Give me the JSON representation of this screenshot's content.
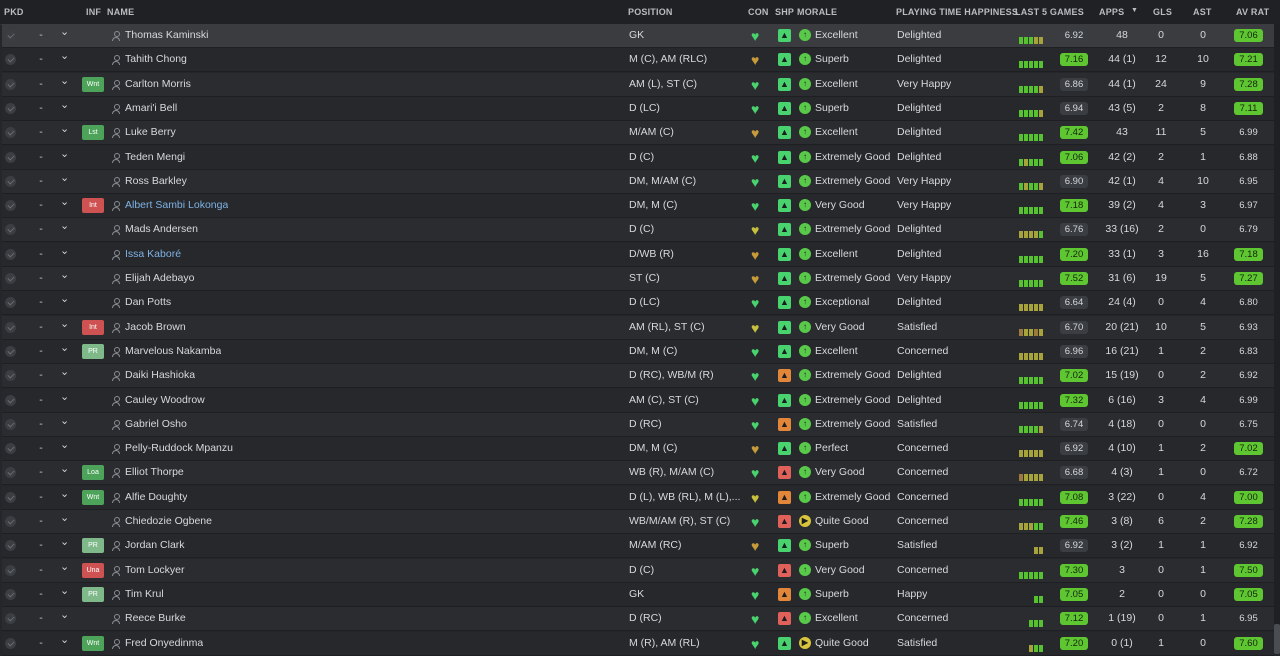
{
  "headers": {
    "pkd": "PKD",
    "inf": "INF",
    "name": "NAME",
    "position": "POSITION",
    "con": "CON",
    "shp": "SHP",
    "morale": "MORALE",
    "playing_time": "PLAYING TIME HAPPINESS",
    "last5": "LAST 5 GAMES",
    "apps": "APPS",
    "sort_indicator": "▼",
    "gls": "GLS",
    "ast": "AST",
    "av_rat": "AV RAT"
  },
  "colors": {
    "bar_green": "#57c22f",
    "bar_olive": "#a5a33a",
    "bar_brown": "#9b7a3c",
    "badge_green": "#4da35a",
    "badge_red": "#cf5252",
    "badge_light": "#7fb889",
    "heart_green": "#49d36e",
    "heart_gold": "#c89b3a",
    "heart_yellow": "#c7c03e",
    "shp_green": "#49d36e",
    "shp_orange": "#e2863a",
    "shp_red": "#e0605a",
    "morale_green": "#59c94a",
    "morale_yellow": "#d9c53c"
  },
  "players": [
    {
      "name": "Thomas Kaminski",
      "inf": "",
      "pkd": "-",
      "position": "GK",
      "con": "heart-green",
      "shp": "green",
      "morale": "Excellent",
      "morale_icon": "up",
      "happiness": "Delighted",
      "last5": [
        "g",
        "g",
        "g",
        "o",
        "o"
      ],
      "l5": "6.92",
      "l5hi": false,
      "apps": "48",
      "gls": "0",
      "ast": "0",
      "avr": "7.06",
      "avrhi": true,
      "link": false
    },
    {
      "name": "Tahith Chong",
      "inf": "",
      "pkd": "-",
      "position": "M (C), AM (RLC)",
      "con": "heart-gold",
      "shp": "green",
      "morale": "Superb",
      "morale_icon": "up",
      "happiness": "Delighted",
      "last5": [
        "g",
        "g",
        "g",
        "g",
        "g"
      ],
      "l5": "7.16",
      "l5hi": true,
      "apps": "44 (1)",
      "gls": "12",
      "ast": "10",
      "avr": "7.21",
      "avrhi": true,
      "link": false
    },
    {
      "name": "Carlton Morris",
      "inf": "Wnt",
      "inf_color": "green",
      "pkd": "-",
      "position": "AM (L), ST (C)",
      "con": "heart-green",
      "shp": "green",
      "morale": "Excellent",
      "morale_icon": "up",
      "happiness": "Very Happy",
      "last5": [
        "g",
        "g",
        "g",
        "g",
        "o"
      ],
      "l5": "6.86",
      "l5hi": false,
      "apps": "44 (1)",
      "gls": "24",
      "ast": "9",
      "avr": "7.28",
      "avrhi": true,
      "link": false
    },
    {
      "name": "Amari'i Bell",
      "inf": "",
      "pkd": "-",
      "position": "D (LC)",
      "con": "heart-green",
      "shp": "green",
      "morale": "Superb",
      "morale_icon": "up",
      "happiness": "Delighted",
      "last5": [
        "g",
        "g",
        "g",
        "g",
        "o"
      ],
      "l5": "6.94",
      "l5hi": false,
      "apps": "43 (5)",
      "gls": "2",
      "ast": "8",
      "avr": "7.11",
      "avrhi": true,
      "link": false
    },
    {
      "name": "Luke Berry",
      "inf": "Lst",
      "inf_color": "green",
      "pkd": "-",
      "position": "M/AM (C)",
      "con": "heart-gold",
      "shp": "green",
      "morale": "Excellent",
      "morale_icon": "up",
      "happiness": "Delighted",
      "last5": [
        "g",
        "g",
        "g",
        "g",
        "g"
      ],
      "l5": "7.42",
      "l5hi": true,
      "apps": "43",
      "gls": "11",
      "ast": "5",
      "avr": "6.99",
      "avrhi": false,
      "link": false
    },
    {
      "name": "Teden Mengi",
      "inf": "",
      "pkd": "-",
      "position": "D (C)",
      "con": "heart-green",
      "shp": "green",
      "morale": "Extremely Good",
      "morale_icon": "up",
      "happiness": "Delighted",
      "last5": [
        "g",
        "o",
        "g",
        "g",
        "g"
      ],
      "l5": "7.06",
      "l5hi": true,
      "apps": "42 (2)",
      "gls": "2",
      "ast": "1",
      "avr": "6.88",
      "avrhi": false,
      "link": false
    },
    {
      "name": "Ross Barkley",
      "inf": "",
      "pkd": "-",
      "position": "DM, M/AM (C)",
      "con": "heart-green",
      "shp": "green",
      "morale": "Extremely Good",
      "morale_icon": "up",
      "happiness": "Very Happy",
      "last5": [
        "g",
        "o",
        "g",
        "g",
        "o"
      ],
      "l5": "6.90",
      "l5hi": false,
      "apps": "42 (1)",
      "gls": "4",
      "ast": "10",
      "avr": "6.95",
      "avrhi": false,
      "link": false
    },
    {
      "name": "Albert Sambi Lokonga",
      "inf": "Int",
      "inf_color": "red",
      "pkd": "-",
      "position": "DM, M (C)",
      "con": "heart-green",
      "shp": "green",
      "morale": "Very Good",
      "morale_icon": "up",
      "happiness": "Very Happy",
      "last5": [
        "g",
        "g",
        "g",
        "g",
        "g"
      ],
      "l5": "7.18",
      "l5hi": true,
      "apps": "39 (2)",
      "gls": "4",
      "ast": "3",
      "avr": "6.97",
      "avrhi": false,
      "link": true
    },
    {
      "name": "Mads Andersen",
      "inf": "",
      "pkd": "-",
      "position": "D (C)",
      "con": "heart-yellow",
      "shp": "green",
      "morale": "Extremely Good",
      "morale_icon": "up",
      "happiness": "Delighted",
      "last5": [
        "o",
        "o",
        "o",
        "o",
        "g"
      ],
      "l5": "6.76",
      "l5hi": false,
      "apps": "33 (16)",
      "gls": "2",
      "ast": "0",
      "avr": "6.79",
      "avrhi": false,
      "link": false
    },
    {
      "name": "Issa Kaboré",
      "inf": "",
      "pkd": "-",
      "position": "D/WB (R)",
      "con": "heart-gold",
      "shp": "green",
      "morale": "Excellent",
      "morale_icon": "up",
      "happiness": "Delighted",
      "last5": [
        "g",
        "g",
        "g",
        "g",
        "g"
      ],
      "l5": "7.20",
      "l5hi": true,
      "apps": "33 (1)",
      "gls": "3",
      "ast": "16",
      "avr": "7.18",
      "avrhi": true,
      "link": true
    },
    {
      "name": "Elijah Adebayo",
      "inf": "",
      "pkd": "-",
      "position": "ST (C)",
      "con": "heart-gold",
      "shp": "green",
      "morale": "Extremely Good",
      "morale_icon": "up",
      "happiness": "Very Happy",
      "last5": [
        "g",
        "g",
        "g",
        "g",
        "g"
      ],
      "l5": "7.52",
      "l5hi": true,
      "apps": "31 (6)",
      "gls": "19",
      "ast": "5",
      "avr": "7.27",
      "avrhi": true,
      "link": false
    },
    {
      "name": "Dan Potts",
      "inf": "",
      "pkd": "-",
      "position": "D (LC)",
      "con": "heart-green",
      "shp": "green",
      "morale": "Exceptional",
      "morale_icon": "up",
      "happiness": "Delighted",
      "last5": [
        "o",
        "o",
        "o",
        "o",
        "o"
      ],
      "l5": "6.64",
      "l5hi": false,
      "apps": "24 (4)",
      "gls": "0",
      "ast": "4",
      "avr": "6.80",
      "avrhi": false,
      "link": false
    },
    {
      "name": "Jacob Brown",
      "inf": "Int",
      "inf_color": "red",
      "pkd": "-",
      "position": "AM (RL), ST (C)",
      "con": "heart-yellow",
      "shp": "green",
      "morale": "Very Good",
      "morale_icon": "up",
      "happiness": "Satisfied",
      "last5": [
        "b",
        "o",
        "o",
        "b",
        "o"
      ],
      "l5": "6.70",
      "l5hi": false,
      "apps": "20 (21)",
      "gls": "10",
      "ast": "5",
      "avr": "6.93",
      "avrhi": false,
      "link": false
    },
    {
      "name": "Marvelous Nakamba",
      "inf": "PR",
      "inf_color": "light",
      "pkd": "-",
      "position": "DM, M (C)",
      "con": "heart-green",
      "shp": "green",
      "morale": "Excellent",
      "morale_icon": "up",
      "happiness": "Concerned",
      "last5": [
        "o",
        "o",
        "o",
        "o",
        "o"
      ],
      "l5": "6.96",
      "l5hi": false,
      "apps": "16 (21)",
      "gls": "1",
      "ast": "2",
      "avr": "6.83",
      "avrhi": false,
      "link": false
    },
    {
      "name": "Daiki Hashioka",
      "inf": "",
      "pkd": "-",
      "position": "D (RC), WB/M (R)",
      "con": "heart-green",
      "shp": "orange",
      "morale": "Extremely Good",
      "morale_icon": "up",
      "happiness": "Delighted",
      "last5": [
        "g",
        "g",
        "g",
        "g",
        "g"
      ],
      "l5": "7.02",
      "l5hi": true,
      "apps": "15 (19)",
      "gls": "0",
      "ast": "2",
      "avr": "6.92",
      "avrhi": false,
      "link": false
    },
    {
      "name": "Cauley Woodrow",
      "inf": "",
      "pkd": "-",
      "position": "AM (C), ST (C)",
      "con": "heart-green",
      "shp": "green",
      "morale": "Extremely Good",
      "morale_icon": "up",
      "happiness": "Delighted",
      "last5": [
        "g",
        "g",
        "g",
        "g",
        "g"
      ],
      "l5": "7.32",
      "l5hi": true,
      "apps": "6 (16)",
      "gls": "3",
      "ast": "4",
      "avr": "6.99",
      "avrhi": false,
      "link": false
    },
    {
      "name": "Gabriel Osho",
      "inf": "",
      "pkd": "-",
      "position": "D (RC)",
      "con": "heart-green",
      "shp": "orange",
      "morale": "Extremely Good",
      "morale_icon": "up",
      "happiness": "Satisfied",
      "last5": [
        "g",
        "g",
        "g",
        "g",
        "o"
      ],
      "l5": "6.74",
      "l5hi": false,
      "apps": "4 (18)",
      "gls": "0",
      "ast": "0",
      "avr": "6.75",
      "avrhi": false,
      "link": false
    },
    {
      "name": "Pelly-Ruddock Mpanzu",
      "inf": "",
      "pkd": "-",
      "position": "DM, M (C)",
      "con": "heart-gold",
      "shp": "green",
      "morale": "Perfect",
      "morale_icon": "up",
      "happiness": "Concerned",
      "last5": [
        "o",
        "o",
        "o",
        "o",
        "o"
      ],
      "l5": "6.92",
      "l5hi": false,
      "apps": "4 (10)",
      "gls": "1",
      "ast": "2",
      "avr": "7.02",
      "avrhi": true,
      "link": false
    },
    {
      "name": "Elliot Thorpe",
      "inf": "Loa",
      "inf_color": "green",
      "pkd": "-",
      "position": "WB (R), M/AM (C)",
      "con": "heart-green",
      "shp": "red",
      "morale": "Very Good",
      "morale_icon": "up",
      "happiness": "Concerned",
      "last5": [
        "b",
        "o",
        "o",
        "o",
        "o"
      ],
      "l5": "6.68",
      "l5hi": false,
      "apps": "4 (3)",
      "gls": "1",
      "ast": "0",
      "avr": "6.72",
      "avrhi": false,
      "link": false
    },
    {
      "name": "Alfie Doughty",
      "inf": "Wnt",
      "inf_color": "green",
      "pkd": "-",
      "position": "D (L), WB (RL), M (L),...",
      "con": "heart-yellow",
      "shp": "orange",
      "morale": "Extremely Good",
      "morale_icon": "up",
      "happiness": "Concerned",
      "last5": [
        "g",
        "g",
        "g",
        "g",
        "g"
      ],
      "l5": "7.08",
      "l5hi": true,
      "apps": "3 (22)",
      "gls": "0",
      "ast": "4",
      "avr": "7.00",
      "avrhi": true,
      "link": false
    },
    {
      "name": "Chiedozie Ogbene",
      "inf": "",
      "pkd": "-",
      "position": "WB/M/AM (R), ST (C)",
      "con": "heart-green",
      "shp": "red",
      "morale": "Quite Good",
      "morale_icon": "right",
      "happiness": "Concerned",
      "last5": [
        "o",
        "o",
        "o",
        "g",
        "g"
      ],
      "l5": "7.46",
      "l5hi": true,
      "apps": "3 (8)",
      "gls": "6",
      "ast": "2",
      "avr": "7.28",
      "avrhi": true,
      "link": false
    },
    {
      "name": "Jordan Clark",
      "inf": "PR",
      "inf_color": "light",
      "pkd": "-",
      "position": "M/AM (RC)",
      "con": "heart-gold",
      "shp": "green",
      "morale": "Superb",
      "morale_icon": "up",
      "happiness": "Satisfied",
      "last5": [
        "",
        "",
        "",
        "o",
        "o"
      ],
      "l5": "6.92",
      "l5hi": false,
      "apps": "3 (2)",
      "gls": "1",
      "ast": "1",
      "avr": "6.92",
      "avrhi": false,
      "link": false
    },
    {
      "name": "Tom Lockyer",
      "inf": "Una",
      "inf_color": "red",
      "pkd": "-",
      "position": "D (C)",
      "con": "heart-green",
      "shp": "red",
      "morale": "Very Good",
      "morale_icon": "up",
      "happiness": "Concerned",
      "last5": [
        "g",
        "g",
        "g",
        "g",
        "g"
      ],
      "l5": "7.30",
      "l5hi": true,
      "apps": "3",
      "gls": "0",
      "ast": "1",
      "avr": "7.50",
      "avrhi": true,
      "link": false
    },
    {
      "name": "Tim Krul",
      "inf": "PR",
      "inf_color": "light",
      "pkd": "-",
      "position": "GK",
      "con": "heart-green",
      "shp": "orange",
      "morale": "Superb",
      "morale_icon": "up",
      "happiness": "Happy",
      "last5": [
        "",
        "",
        "",
        "g",
        "g"
      ],
      "l5": "7.05",
      "l5hi": true,
      "apps": "2",
      "gls": "0",
      "ast": "0",
      "avr": "7.05",
      "avrhi": true,
      "link": false
    },
    {
      "name": "Reece Burke",
      "inf": "",
      "pkd": "-",
      "position": "D (RC)",
      "con": "heart-green",
      "shp": "red",
      "morale": "Excellent",
      "morale_icon": "up",
      "happiness": "Concerned",
      "last5": [
        "",
        "",
        "g",
        "g",
        "g"
      ],
      "l5": "7.12",
      "l5hi": true,
      "apps": "1 (19)",
      "gls": "0",
      "ast": "1",
      "avr": "6.95",
      "avrhi": false,
      "link": false
    },
    {
      "name": "Fred Onyedinma",
      "inf": "Wnt",
      "inf_color": "green",
      "pkd": "-",
      "position": "M (R), AM (RL)",
      "con": "heart-green",
      "shp": "green",
      "morale": "Quite Good",
      "morale_icon": "right",
      "happiness": "Satisfied",
      "last5": [
        "",
        "",
        "o",
        "g",
        "g"
      ],
      "l5": "7.20",
      "l5hi": true,
      "apps": "0 (1)",
      "gls": "1",
      "ast": "0",
      "avr": "7.60",
      "avrhi": true,
      "link": false
    }
  ]
}
